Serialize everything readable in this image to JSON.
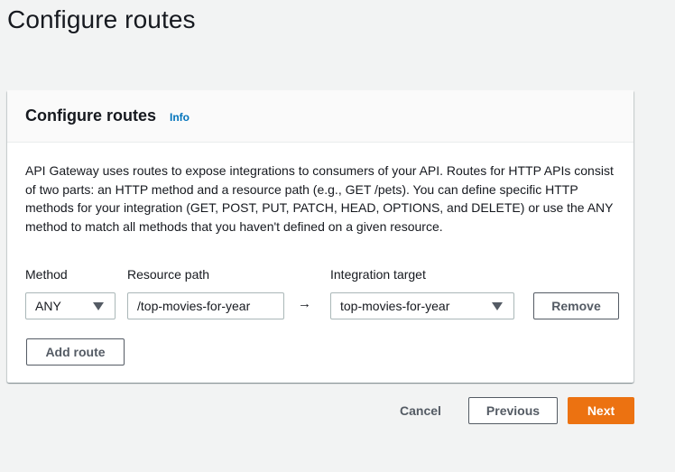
{
  "page": {
    "title": "Configure routes"
  },
  "panel": {
    "title": "Configure routes",
    "info_link": "Info",
    "description": "API Gateway uses routes to expose integrations to consumers of your API. Routes for HTTP APIs consist of two parts: an HTTP method and a resource path (e.g., GET /pets). You can define specific HTTP methods for your integration (GET, POST, PUT, PATCH, HEAD, OPTIONS, and DELETE) or use the ANY method to match all methods that you haven't defined on a given resource."
  },
  "route": {
    "method_label": "Method",
    "method_value": "ANY",
    "resource_path_label": "Resource path",
    "resource_path_value": "/top-movies-for-year",
    "arrow": "→",
    "integration_target_label": "Integration target",
    "integration_target_value": "top-movies-for-year",
    "remove_label": "Remove"
  },
  "actions": {
    "add_route_label": "Add route",
    "cancel_label": "Cancel",
    "previous_label": "Previous",
    "next_label": "Next"
  },
  "colors": {
    "primary": "#ec7211",
    "link": "#0073bb",
    "background": "#f2f3f3"
  },
  "icons": {
    "dropdown": "caret-down-icon",
    "arrow": "arrow-right-icon"
  }
}
